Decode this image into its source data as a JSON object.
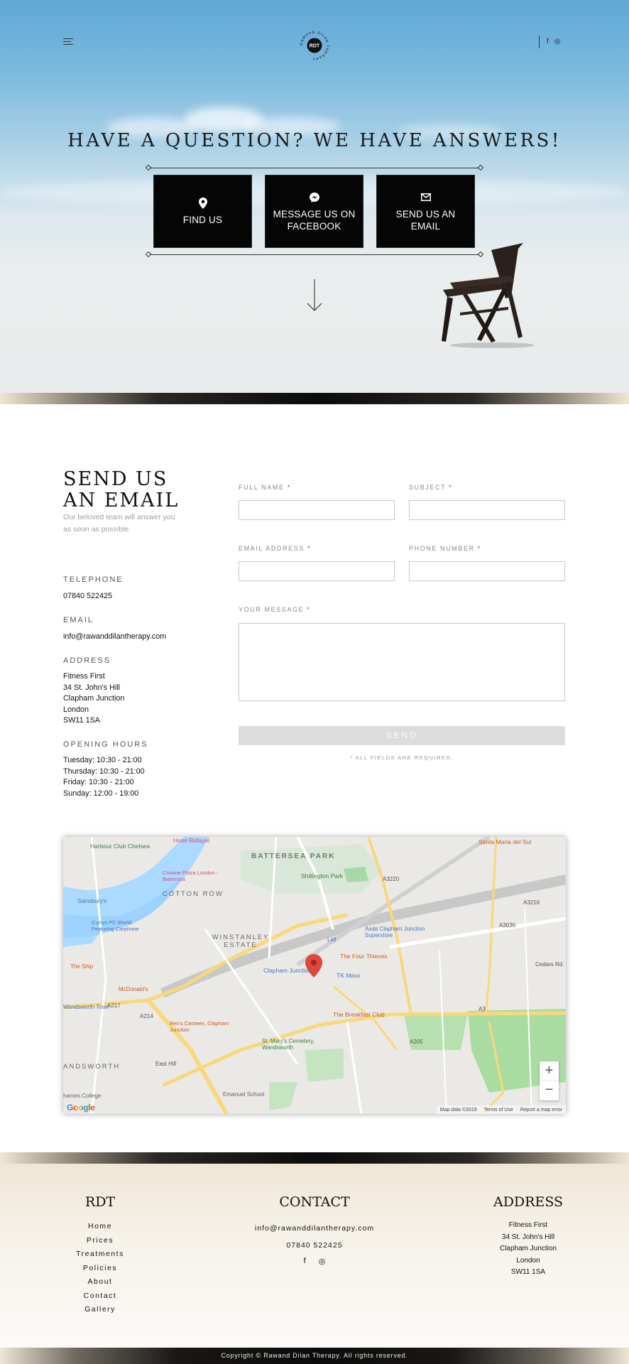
{
  "header": {
    "logo_text": "RDT",
    "logo_ring_text": "RAWAND DILAN THERAPY",
    "social": [
      {
        "icon": "facebook-icon",
        "glyph": "f"
      },
      {
        "icon": "instagram-icon",
        "glyph": "◎"
      }
    ]
  },
  "hero": {
    "title": "HAVE A QUESTION? WE HAVE ANSWERS!",
    "boxes": [
      {
        "label": "FIND US",
        "icon": "map-pin-icon"
      },
      {
        "label": "MESSAGE US ON FACEBOOK",
        "icon": "messenger-icon"
      },
      {
        "label": "SEND US AN EMAIL",
        "icon": "envelope-icon"
      }
    ]
  },
  "contact": {
    "title_line1": "SEND US",
    "title_line2": "AN EMAIL",
    "subtitle": "Our beloved team will answer you as soon as possible",
    "telephone_label": "TELEPHONE",
    "telephone": "07840 522425",
    "email_label": "EMAIL",
    "email": "info@rawanddilantherapy.com",
    "address_label": "ADDRESS",
    "address": [
      "Fitness First",
      "34 St. John's Hill",
      "Clapham Junction",
      "London",
      "SW11 1SA"
    ],
    "hours_label": "OPENING HOURS",
    "hours": [
      "Tuesday: 10:30 - 21:00",
      "Thursday: 10:30 - 21:00",
      "Friday: 10:30 - 21:00",
      "Sunday: 12:00 - 19:00"
    ]
  },
  "form": {
    "full_name_label": "FULL NAME",
    "subject_label": "SUBJECT",
    "email_label": "EMAIL ADDRESS",
    "phone_label": "PHONE NUMBER",
    "message_label": "YOUR MESSAGE",
    "required_mark": "*",
    "send_label": "SEND",
    "required_note": "* ALL FIELDS ARE REQUIRED."
  },
  "map": {
    "labels": {
      "harbour_club": "Harbour Club Chelsea",
      "hotel_rafayel": "Hotel Rafayel",
      "battersea_park": "BATTERSEA PARK",
      "shillington_park": "Shillington Park",
      "crowne_plaza": "Crowne Plaza London - Battersea",
      "cotton_row": "COTTON ROW",
      "sainsburys": "Sainsbury's",
      "currys": "Currys PC World Featuring Carphone",
      "winstanley": "WINSTANLEY ESTATE",
      "lidl": "Lidl",
      "asda": "Asda Clapham Junction Superstore",
      "four_thieves": "The Four Thieves",
      "clapham_junction": "Clapham Junction",
      "tk_maxx": "TK Maxx",
      "the_ship": "The Ship",
      "mcdonalds": "McDonald's",
      "wandsworth_town": "Wandsworth Town",
      "bens_canteen": "Ben's Canteen, Clapham Junction",
      "breakfast_club": "The Breakfast Club",
      "st_marys": "St. Mary's Cemetery, Wandsworth",
      "wandsworth": "ANDSWORTH",
      "emanuel_school": "Emanuel School",
      "thames_college": "hames College",
      "santa_maria": "Santa Maria del Sur",
      "a3": "A3",
      "a205": "A205",
      "a3220": "A3220",
      "a3036": "A3036",
      "a217": "A217",
      "a214": "A214",
      "a3216": "A3216",
      "east_hill": "East Hill",
      "cedars_rd": "Cedars Rd"
    },
    "zoom_in": "+",
    "zoom_out": "−",
    "google": "Google",
    "map_data": "Map data ©2019",
    "terms": "Terms of Use",
    "report": "Report a map error"
  },
  "footer": {
    "col1_title": "RDT",
    "links": [
      "Home",
      "Prices",
      "Treatments",
      "Policies",
      "About",
      "Contact",
      "Gallery"
    ],
    "col2_title": "CONTACT",
    "email": "info@rawanddilantherapy.com",
    "phone": "07840 522425",
    "col3_title": "ADDRESS",
    "address": [
      "Fitness First",
      "34 St. John's Hill",
      "Clapham Junction",
      "London",
      "SW11 1SA"
    ],
    "copyright": "Copyright © Rawand Dilan Therapy. All rights reserved."
  }
}
